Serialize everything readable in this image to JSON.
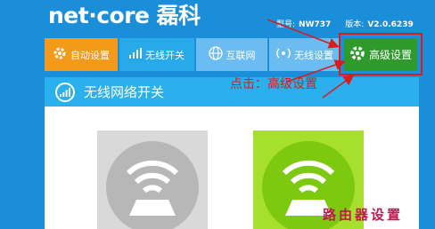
{
  "brand": {
    "logo_text": "net·core 磊科"
  },
  "header": {
    "model_label": "型号:",
    "model_value": "NW737",
    "version_label": "版本:",
    "version_value": "V2.0.6239"
  },
  "nav": {
    "items": [
      {
        "label": "自动设置",
        "icon": "gear-icon"
      },
      {
        "label": "无线开关",
        "icon": "signal-bars-icon"
      },
      {
        "label": "互联网",
        "icon": "globe-icon"
      },
      {
        "label": "无线设置",
        "icon": "wireless-icon"
      },
      {
        "label": "高级设置",
        "icon": "gear-icon"
      }
    ]
  },
  "section": {
    "title": "无线网络开关",
    "icon": "signal-circle-icon"
  },
  "annotation": {
    "text": "点击：高级设置"
  },
  "wifi_tiles": [
    {
      "state": "off",
      "color": "#b7b7b7"
    },
    {
      "state": "on",
      "color": "#7cc910"
    }
  ],
  "watermark": {
    "text": "路由器设置"
  },
  "colors": {
    "background": "#1a8ed8",
    "accent_orange": "#f39a1b",
    "active_blue": "#27a9ea",
    "inactive_blue": "#6bbcf0",
    "advanced_green": "#2e9a2c",
    "annotation_red": "#d81d1d"
  }
}
